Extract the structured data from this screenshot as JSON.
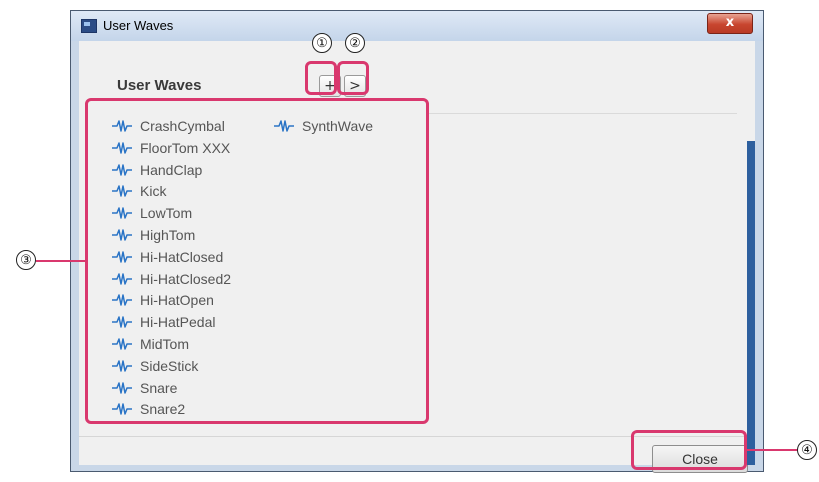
{
  "window": {
    "title": "User Waves",
    "close_glyph": "x"
  },
  "panel": {
    "heading": "User Waves",
    "add_button_label": "+",
    "next_button_label": ">"
  },
  "waves": {
    "column1": [
      "CrashCymbal",
      "FloorTom XXX",
      "HandClap",
      "Kick",
      "LowTom",
      "HighTom",
      "Hi-HatClosed",
      "Hi-HatClosed2",
      "Hi-HatOpen",
      "Hi-HatPedal",
      "MidTom",
      "SideStick",
      "Snare",
      "Snare2"
    ],
    "column2": [
      "SynthWave"
    ]
  },
  "footer": {
    "close_label": "Close"
  },
  "callouts": [
    "①",
    "②",
    "③",
    "④"
  ],
  "colors": {
    "callout_highlight": "#d9386e",
    "wave_icon": "#2a74c6"
  },
  "icons": {
    "wave": "waveform-icon",
    "app": "app-window-icon"
  }
}
